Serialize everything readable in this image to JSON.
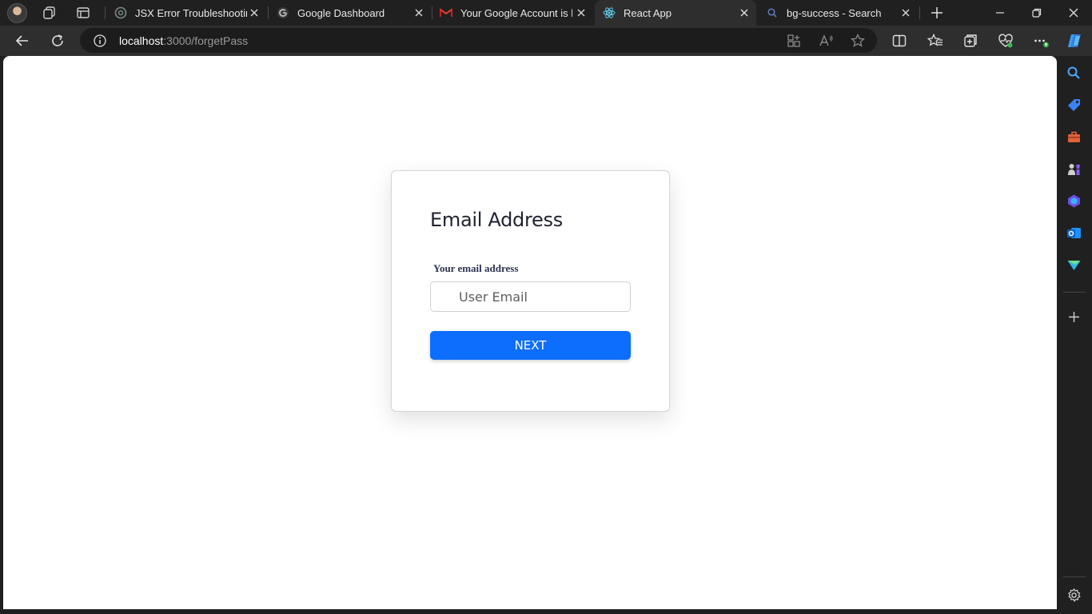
{
  "browser": {
    "tabs": [
      {
        "title": "JSX Error Troubleshooting",
        "favicon": "chatgpt-icon",
        "active": false
      },
      {
        "title": "Google Dashboard",
        "favicon": "google-icon",
        "active": false
      },
      {
        "title": "Your Google Account is liv",
        "favicon": "gmail-icon",
        "active": false
      },
      {
        "title": "React App",
        "favicon": "react-icon",
        "active": true
      },
      {
        "title": "bg-success - Search",
        "favicon": "search-icon",
        "active": false
      }
    ],
    "address": {
      "host": "localhost",
      "path": ":3000/forgetPass"
    },
    "accent_color": "#0d6efd"
  },
  "page": {
    "heading": "Email Address",
    "email_label": "Your email address",
    "email_placeholder": "User Email",
    "next_button": "NEXT"
  }
}
